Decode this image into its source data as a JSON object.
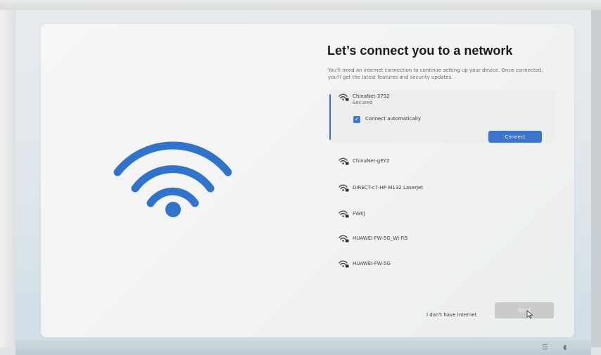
{
  "setup": {
    "title": "Let’s connect you to a network",
    "subtitle": "You'll need an internet connection to continue setting up your device. Once connected, you'll get the latest features and security updates."
  },
  "networks": {
    "selected": {
      "name": "ChinaNet-3792",
      "status": "Secured",
      "auto_label": "Connect automatically",
      "auto_checked": true,
      "connect_label": "Connect"
    },
    "items": [
      {
        "name": "ChinaNet-gEY2"
      },
      {
        "name": "DIRECT-c7-HP M132 LaserJet"
      },
      {
        "name": "FWKJ"
      },
      {
        "name": "HUAWEI-FW-5G_Wi-Fi5"
      },
      {
        "name": "HUAWEI-FW-5G"
      }
    ]
  },
  "footer": {
    "no_internet_label": "I don't have internet",
    "next_label": "Next"
  },
  "icons": {
    "hero": "wifi-icon",
    "network": "wifi-lock-icon",
    "check": "checkmark-icon"
  },
  "colors": {
    "accent": "#3b74cd",
    "hero_wifi": "#2f73cc"
  }
}
